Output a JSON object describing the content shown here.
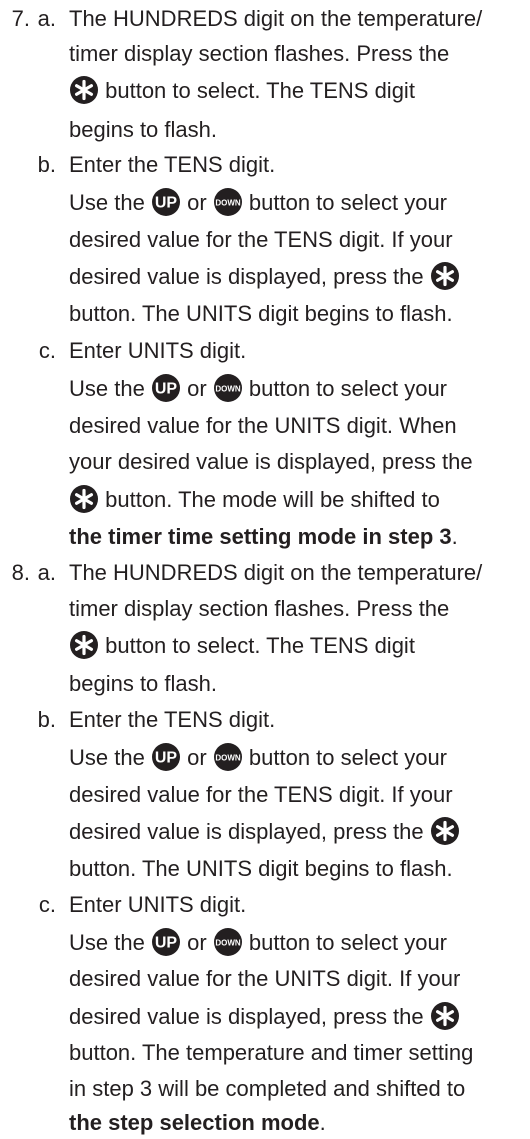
{
  "steps": [
    {
      "number": "7.",
      "substeps": [
        {
          "letter": "a.",
          "lines": [
            "The HUNDREDS digit on the temperature/",
            "timer display section flashes. Press the",
            "button to select. The TENS digit",
            "begins to flash."
          ]
        },
        {
          "letter": "b.",
          "lines": [
            "Enter the TENS digit.",
            "Use the",
            "or",
            "button to select your",
            "desired value for the TENS digit. If your",
            "desired value is displayed, press the",
            "button. The UNITS digit begins to flash."
          ]
        },
        {
          "letter": "c.",
          "lines": [
            "Enter UNITS digit.",
            "Use the",
            "or",
            "button to select your",
            "desired value for the UNITS digit. When",
            "your desired value is displayed, press the",
            "button. The mode will be shifted to",
            "the timer time setting mode in step 3",
            "."
          ]
        }
      ]
    },
    {
      "number": "8.",
      "substeps": [
        {
          "letter": "a.",
          "lines": [
            "The HUNDREDS digit on the temperature/",
            "timer display section flashes. Press the",
            "button to select. The TENS digit",
            "begins to flash."
          ]
        },
        {
          "letter": "b.",
          "lines": [
            "Enter the TENS digit.",
            "Use the",
            "or",
            "button to select your",
            "desired value for the TENS digit. If your",
            "desired value is displayed, press the",
            "button. The UNITS digit begins to flash."
          ]
        },
        {
          "letter": "c.",
          "lines": [
            "Enter UNITS digit.",
            "Use the",
            "or",
            "button to select your",
            "desired value for the UNITS digit. If your",
            "desired value is displayed, press the",
            "button. The temperature and timer setting",
            "in step 3 will be completed and shifted to",
            "the step selection mode",
            "."
          ]
        }
      ]
    }
  ],
  "icons": {
    "up_label": "UP",
    "down_label": "DOWN",
    "icon_color": "#231f20"
  }
}
